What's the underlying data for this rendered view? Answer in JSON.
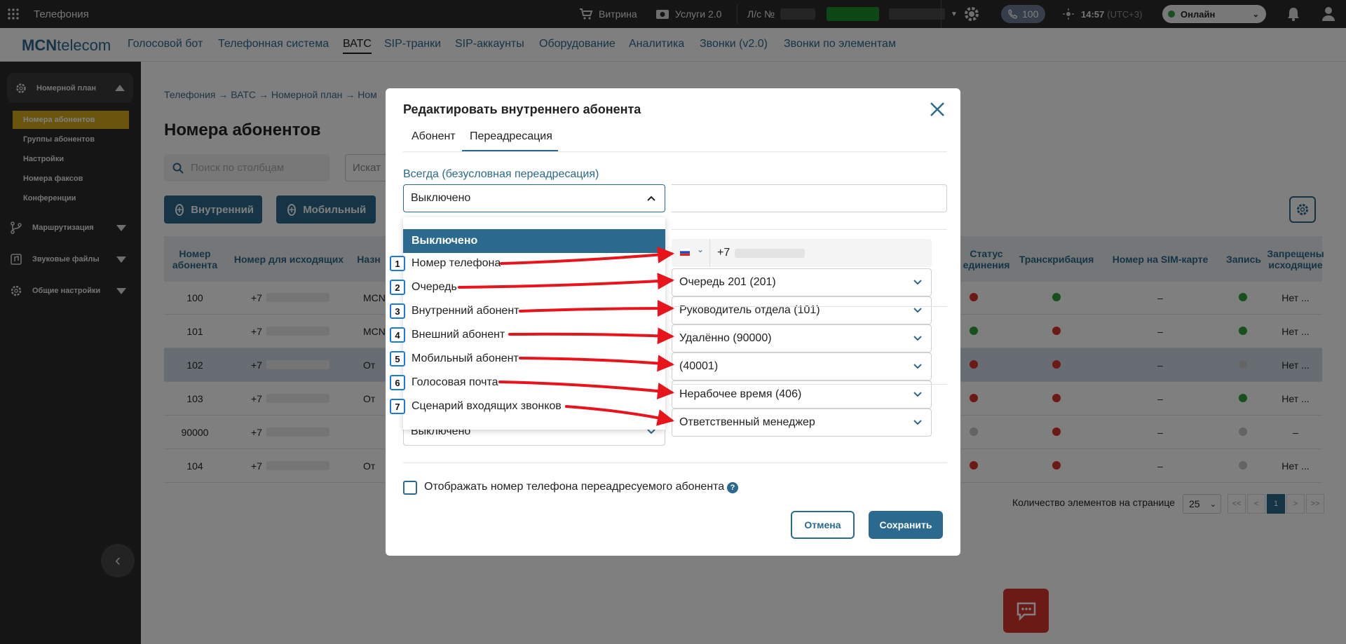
{
  "topbar": {
    "app_name": "Телефония",
    "vitrina": "Витрина",
    "services": "Услуги 2.0",
    "account_label": "Л/с №",
    "calls_count": "100",
    "time": "14:57",
    "timezone": "(UTC+3)",
    "status": "Онлайн"
  },
  "nav": {
    "logo_bold": "MCN",
    "logo_rest": "telecom",
    "links": [
      "Голосовой бот",
      "Телефонная система",
      "ВАТС",
      "SIP-транки",
      "SIP-аккаунты",
      "Оборудование",
      "Аналитика",
      "Звонки (v2.0)",
      "Звонки по элементам"
    ]
  },
  "sidebar": {
    "group": "Номерной план",
    "items": [
      "Номера абонентов",
      "Группы абонентов",
      "Настройки",
      "Номера факсов",
      "Конференции"
    ],
    "sections": [
      "Маршрутизация",
      "Звуковые файлы",
      "Общие настройки"
    ]
  },
  "page": {
    "breadcrumb": [
      "Телефония",
      "ВАТС",
      "Номерной план",
      "Ном"
    ],
    "title": "Номера абонентов",
    "search_placeholder": "Поиск по столбцам",
    "search2_placeholder": "Искат",
    "btn_internal": "Внутренний",
    "btn_mobile": "Мобильный"
  },
  "table": {
    "headers": [
      "Номер абонента",
      "Номер для исходящих",
      "Назн",
      "Статус единения",
      "Транскрибация",
      "Номер на SIM-карте",
      "Запись",
      "Запрещены исходящие"
    ],
    "rows": [
      {
        "num": "100",
        "out": "+7",
        "name": "MCN",
        "s1": "red",
        "s2": "green",
        "sim": "–",
        "rec": "green",
        "ban": "Нет ..."
      },
      {
        "num": "101",
        "out": "+7",
        "name": "MCN",
        "s1": "green",
        "s2": "red",
        "sim": "–",
        "rec": "green",
        "ban": "Нет ..."
      },
      {
        "num": "102",
        "out": "+7",
        "name": "От",
        "s1": "red",
        "s2": "red",
        "sim": "–",
        "rec": "grey",
        "ban": "Нет ..."
      },
      {
        "num": "103",
        "out": "+7",
        "name": "От",
        "s1": "red",
        "s2": "red",
        "sim": "–",
        "rec": "green",
        "ban": "Нет ..."
      },
      {
        "num": "90000",
        "out": "+7",
        "name": "",
        "s1": "grey",
        "s2": "red",
        "sim": "–",
        "rec": "grey",
        "ban": "–"
      },
      {
        "num": "104",
        "out": "+7",
        "name": "От",
        "s1": "red",
        "s2": "red",
        "sim": "–",
        "rec": "grey",
        "ban": "Нет ..."
      }
    ],
    "pager_label": "Количество элементов на странице",
    "page_size": "25",
    "pages": [
      "<<",
      "<",
      "1",
      ">",
      ">>"
    ]
  },
  "modal": {
    "title": "Редактировать внутреннего абонента",
    "tabs": [
      "Абонент",
      "Переадресация"
    ],
    "field_label": "Всегда (безусловная переадресация)",
    "field_value": "Выключено",
    "dropdown_selected": "Выключено",
    "dropdown_options": [
      "Номер телефона",
      "Очередь",
      "Внутренний абонент",
      "Внешний абонент",
      "Мобильный абонент",
      "Голосовая почта",
      "Сценарий входящих звонков"
    ],
    "phone_prefix": "+7",
    "targets": [
      "Очередь 201 (201)",
      "Руководитель отдела (101)",
      "Удалённо (90000)",
      "(40001)",
      "Нерабочее время (406)",
      "Ответственный менеджер"
    ],
    "bottom_select_value": "Выключено",
    "checkbox_label": "Отображать номер телефона переадресуемого абонента",
    "help": "?",
    "cancel": "Отмена",
    "save": "Сохранить"
  },
  "annotations": [
    "1",
    "2",
    "3",
    "4",
    "5",
    "6",
    "7"
  ],
  "colors": {
    "brand": "#2a6a8f",
    "accent_sidebar": "#d6a91a",
    "arrow": "#e8141c",
    "badge_border": "#1b78e0",
    "green": "#2e9e3c",
    "red": "#d9342b"
  }
}
